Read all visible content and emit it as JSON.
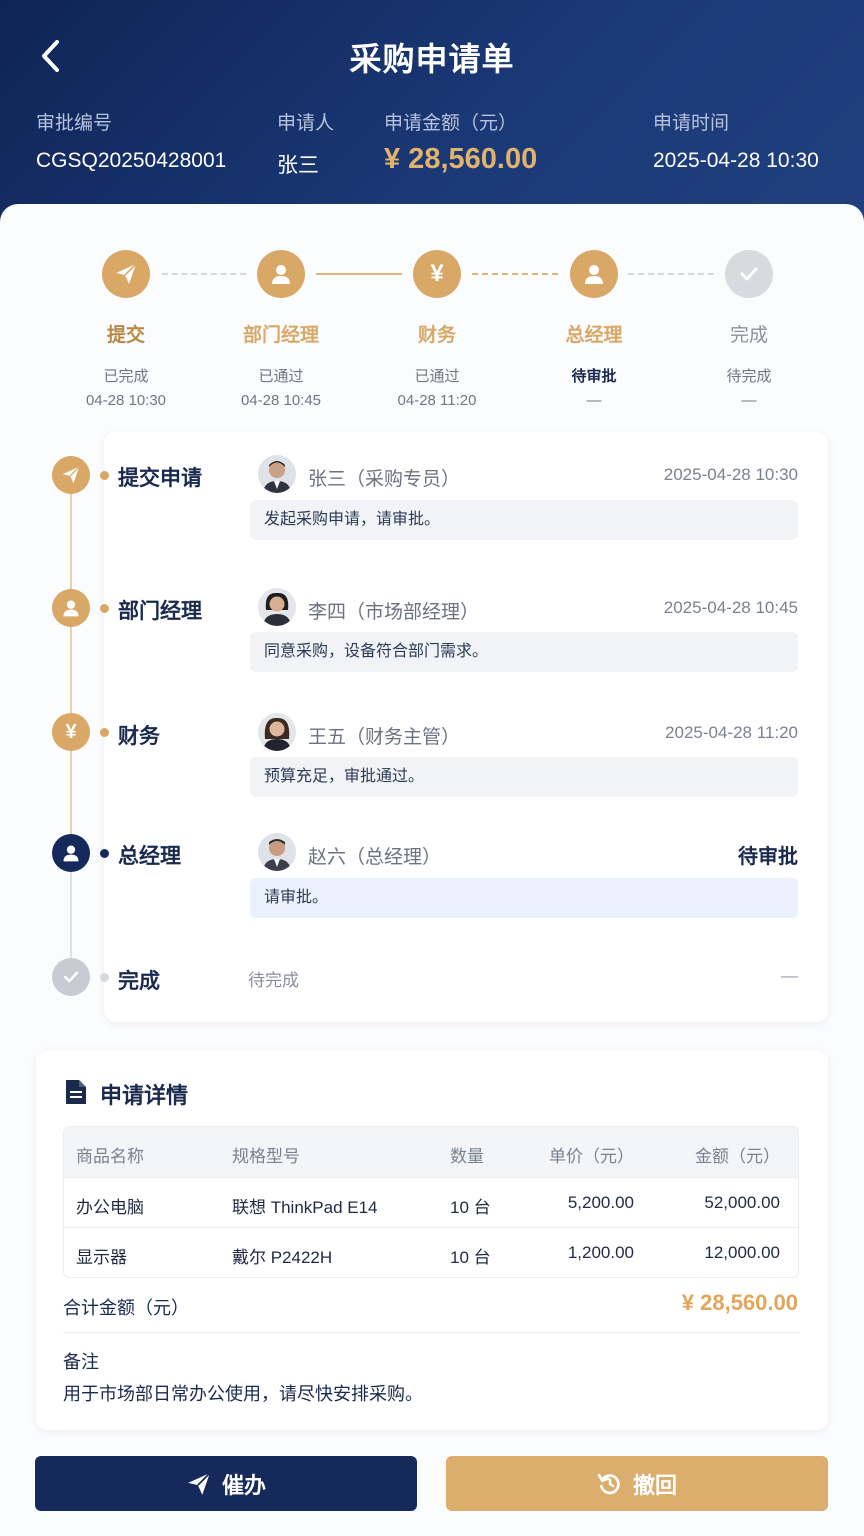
{
  "header": {
    "title": "采购申请单",
    "approval_no_label": "审批编号",
    "approval_no": "CGSQ20250428001",
    "applicant_label": "申请人",
    "applicant": "张三",
    "amount_label": "申请金额（元）",
    "amount": "¥ 28,560.00",
    "time_label": "申请时间",
    "time": "2025-04-28 10:30"
  },
  "steps": [
    {
      "name": "提交",
      "status": "已完成",
      "time": "04-28 10:30",
      "icon": "paper-plane-icon"
    },
    {
      "name": "部门经理",
      "status": "已通过",
      "time": "04-28 10:45",
      "icon": "user-icon"
    },
    {
      "name": "财务",
      "status": "已通过",
      "time": "04-28 11:20",
      "icon": "yen-icon"
    },
    {
      "name": "总经理",
      "status": "待审批",
      "time": "—",
      "icon": "user-icon"
    },
    {
      "name": "完成",
      "status": "待完成",
      "time": "—",
      "icon": "check-icon"
    }
  ],
  "timeline": [
    {
      "title": "提交申请",
      "person": "张三（采购专员）",
      "time": "2025-04-28 10:30",
      "comment": "发起采购申请，请审批。"
    },
    {
      "title": "部门经理",
      "person": "李四（市场部经理）",
      "time": "2025-04-28 10:45",
      "comment": "同意采购，设备符合部门需求。"
    },
    {
      "title": "财务",
      "person": "王五（财务主管）",
      "time": "2025-04-28 11:20",
      "comment": "预算充足，审批通过。"
    },
    {
      "title": "总经理",
      "person": "赵六（总经理）",
      "time": "待审批",
      "comment": "请审批。"
    },
    {
      "title": "完成",
      "person": "待完成",
      "time": "—",
      "comment": ""
    }
  ],
  "details": {
    "title": "申请详情",
    "columns": [
      "商品名称",
      "规格型号",
      "数量",
      "单价（元）",
      "金额（元）"
    ],
    "rows": [
      [
        "办公电脑",
        "联想 ThinkPad E14",
        "10 台",
        "5,200.00",
        "52,000.00"
      ],
      [
        "显示器",
        "戴尔 P2422H",
        "10 台",
        "1,200.00",
        "12,000.00"
      ]
    ],
    "total_label": "合计金额（元）",
    "total": "¥ 28,560.00",
    "note_label": "备注",
    "note": "用于市场部日常办公使用，请尽快安排采购。"
  },
  "actions": {
    "urge": "催办",
    "withdraw": "撤回"
  },
  "colors": {
    "navy": "#15295b",
    "gold": "#d9a866",
    "header": "#0f2456"
  }
}
